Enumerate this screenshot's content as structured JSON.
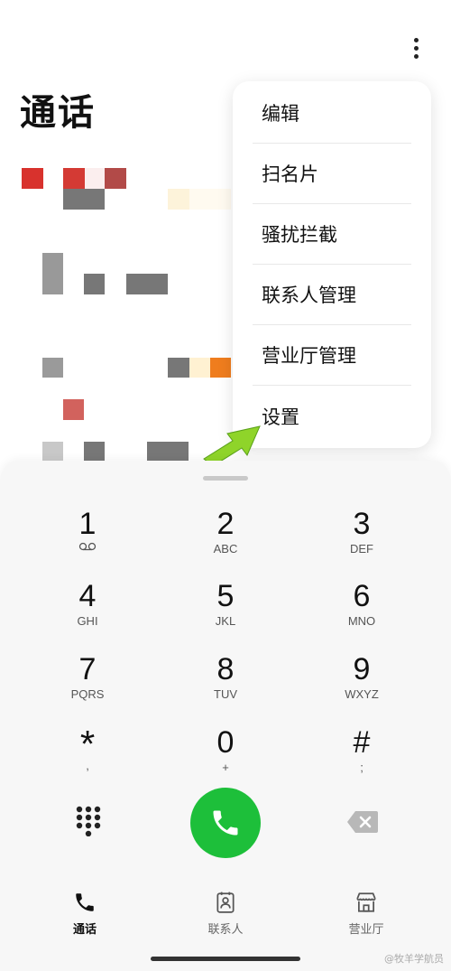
{
  "header": {
    "title": "通话"
  },
  "menu": {
    "items": [
      {
        "label": "编辑"
      },
      {
        "label": "扫名片"
      },
      {
        "label": "骚扰拦截"
      },
      {
        "label": "联系人管理"
      },
      {
        "label": "营业厅管理"
      },
      {
        "label": "设置"
      }
    ]
  },
  "keypad": {
    "keys": [
      {
        "digit": "1",
        "letters": ""
      },
      {
        "digit": "2",
        "letters": "ABC"
      },
      {
        "digit": "3",
        "letters": "DEF"
      },
      {
        "digit": "4",
        "letters": "GHI"
      },
      {
        "digit": "5",
        "letters": "JKL"
      },
      {
        "digit": "6",
        "letters": "MNO"
      },
      {
        "digit": "7",
        "letters": "PQRS"
      },
      {
        "digit": "8",
        "letters": "TUV"
      },
      {
        "digit": "9",
        "letters": "WXYZ"
      },
      {
        "digit": "*",
        "letters": ","
      },
      {
        "digit": "0",
        "letters": "+"
      },
      {
        "digit": "#",
        "letters": ";"
      }
    ]
  },
  "nav": {
    "items": [
      {
        "label": "通话",
        "icon": "phone-icon",
        "active": true
      },
      {
        "label": "联系人",
        "icon": "contacts-icon",
        "active": false
      },
      {
        "label": "营业厅",
        "icon": "store-icon",
        "active": false
      }
    ]
  },
  "watermark": "@牧羊学航员",
  "colors": {
    "call_green": "#1dbf3a",
    "arrow_green": "#8fd42a"
  }
}
